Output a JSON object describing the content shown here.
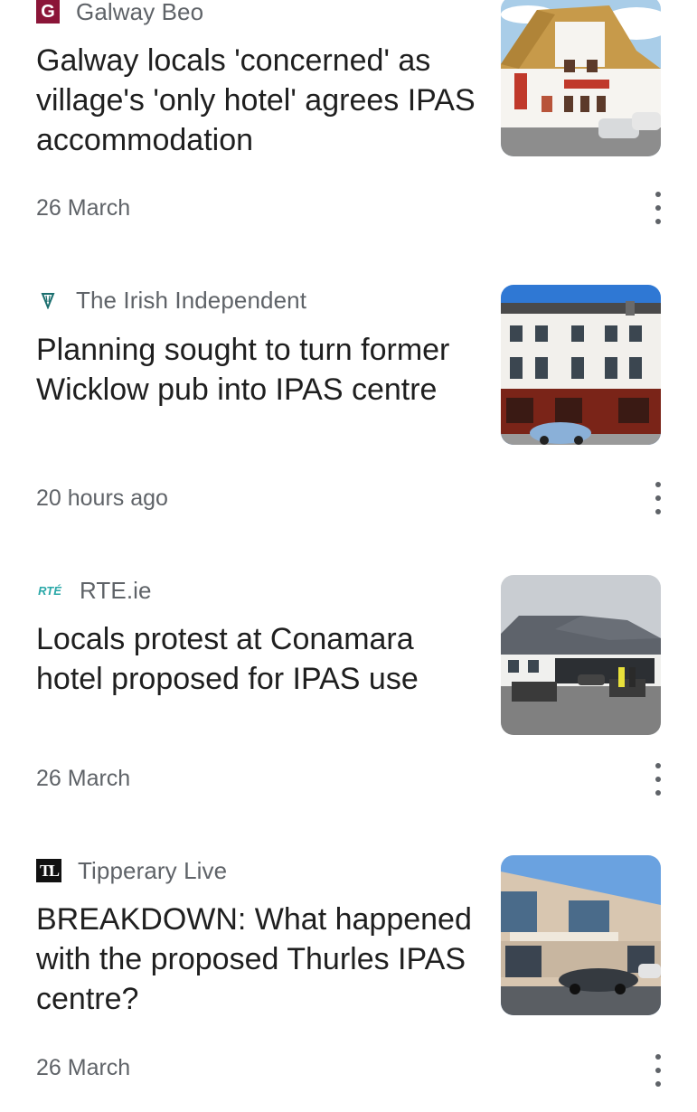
{
  "articles": [
    {
      "source": "Galway Beo",
      "logo_text": "G",
      "logo_icon": "galway-beo-logo-icon",
      "headline": "Galway locals 'concerned' as village's 'only hotel' agrees IPAS accommodation",
      "date": "26 March",
      "thumbnail": "thatched-hotel-photo"
    },
    {
      "source": "The Irish Independent",
      "logo_text": "",
      "logo_icon": "harp-logo-icon",
      "headline": "Planning sought to turn former Wicklow pub into IPAS centre",
      "date": "20 hours ago",
      "thumbnail": "wicklow-pub-photo"
    },
    {
      "source": "RTE.ie",
      "logo_text": "RTÉ",
      "logo_icon": "rte-logo-icon",
      "headline": "Locals protest at Conamara hotel proposed for IPAS use",
      "date": "26 March",
      "thumbnail": "conamara-hotel-photo"
    },
    {
      "source": "Tipperary Live",
      "logo_text": "TL",
      "logo_icon": "tipperary-live-logo-icon",
      "headline": "BREAKDOWN: What happened with the proposed Thurles IPAS centre?",
      "date": "26 March",
      "thumbnail": "thurles-building-photo"
    }
  ],
  "icons": {
    "more_menu": "more-vert-icon"
  },
  "colors": {
    "galway_beo_brand": "#8b1538",
    "rte_brand": "#2aa8a8",
    "text_primary": "#1f1f1f",
    "text_secondary": "#5f6368"
  }
}
